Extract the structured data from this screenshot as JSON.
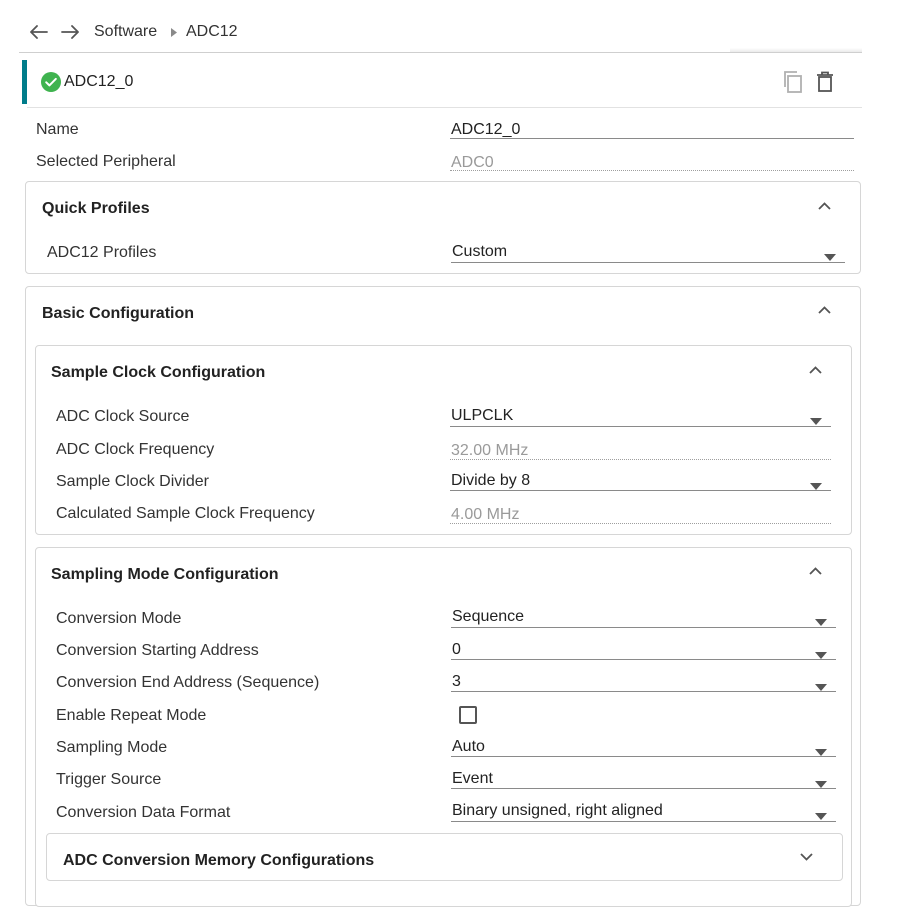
{
  "breadcrumb": {
    "items": [
      "Software",
      "ADC12"
    ]
  },
  "instance": {
    "name": "ADC12_0",
    "status_color": "#3fb34f",
    "accent_color": "#007c8a",
    "icons": {
      "status": "check-circle-icon",
      "copy": "copy-icon",
      "delete": "trash-icon"
    }
  },
  "top_fields": {
    "name": {
      "label": "Name",
      "value": "ADC12_0"
    },
    "selected_peripheral": {
      "label": "Selected Peripheral",
      "value": "ADC0"
    }
  },
  "quick_profiles": {
    "title": "Quick Profiles",
    "adc12_profiles": {
      "label": "ADC12 Profiles",
      "value": "Custom"
    }
  },
  "basic_configuration": {
    "title": "Basic Configuration",
    "sample_clock": {
      "title": "Sample Clock Configuration",
      "clock_source": {
        "label": "ADC Clock Source",
        "value": "ULPCLK"
      },
      "clock_frequency": {
        "label": "ADC Clock Frequency",
        "value": "32.00 MHz"
      },
      "clock_divider": {
        "label": "Sample Clock Divider",
        "value": "Divide by 8"
      },
      "calc_frequency": {
        "label": "Calculated Sample Clock Frequency",
        "value": "4.00 MHz"
      }
    },
    "sampling_mode": {
      "title": "Sampling Mode Configuration",
      "conversion_mode": {
        "label": "Conversion Mode",
        "value": "Sequence"
      },
      "start_address": {
        "label": "Conversion Starting Address",
        "value": "0"
      },
      "end_address": {
        "label": "Conversion End Address (Sequence)",
        "value": "3"
      },
      "repeat_mode": {
        "label": "Enable Repeat Mode",
        "checked": false
      },
      "sampling_mode": {
        "label": "Sampling Mode",
        "value": "Auto"
      },
      "trigger_source": {
        "label": "Trigger Source",
        "value": "Event"
      },
      "data_format": {
        "label": "Conversion Data Format",
        "value": "Binary unsigned, right aligned"
      }
    },
    "memory_config": {
      "title": "ADC Conversion Memory Configurations",
      "expanded": false
    }
  }
}
